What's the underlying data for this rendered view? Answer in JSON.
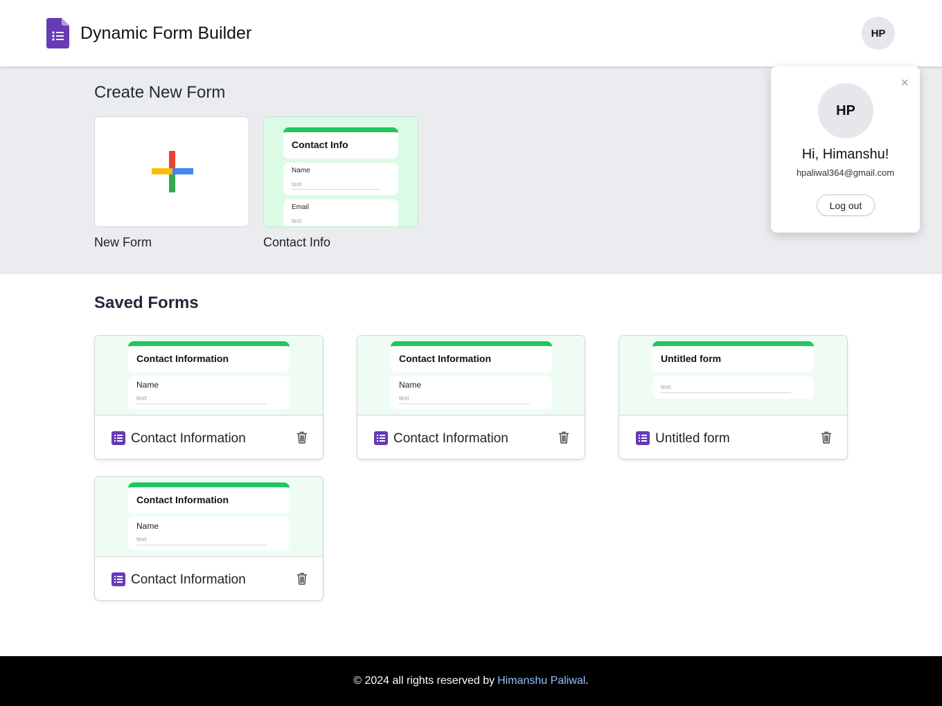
{
  "header": {
    "app_title": "Dynamic Form Builder",
    "logo_icon": "google-forms-icon",
    "avatar_initials": "HP"
  },
  "create_section": {
    "title": "Create New Form",
    "templates": [
      {
        "label": "New Form",
        "icon": "plus-icon"
      },
      {
        "label": "Contact Info",
        "preview": {
          "form_title": "Contact Info",
          "fields": [
            {
              "label": "Name",
              "placeholder": "text"
            },
            {
              "label": "Email",
              "placeholder": "text"
            }
          ]
        }
      }
    ]
  },
  "saved_section": {
    "title": "Saved Forms",
    "forms": [
      {
        "name": "Contact Information",
        "preview_title": "Contact Information",
        "field_label": "Name",
        "field_placeholder": "text"
      },
      {
        "name": "Contact Information",
        "preview_title": "Contact Information",
        "field_label": "Name",
        "field_placeholder": "text"
      },
      {
        "name": "Untitled form",
        "preview_title": "Untitled form",
        "field_label": "",
        "field_placeholder": "text"
      },
      {
        "name": "Contact Information",
        "preview_title": "Contact Information",
        "field_label": "Name",
        "field_placeholder": "text"
      }
    ]
  },
  "profile_popover": {
    "initials": "HP",
    "greeting": "Hi, Himanshu!",
    "email": "hpaliwal364@gmail.com",
    "logout_label": "Log out",
    "close_symbol": "×"
  },
  "footer": {
    "text": "© 2024 all rights reserved by",
    "author_link": "Himanshu Paliwal",
    "suffix": "."
  },
  "colors": {
    "brand_purple": "#673ab7",
    "form_accent_green": "#22c55e",
    "link_blue": "#93c5fd"
  }
}
